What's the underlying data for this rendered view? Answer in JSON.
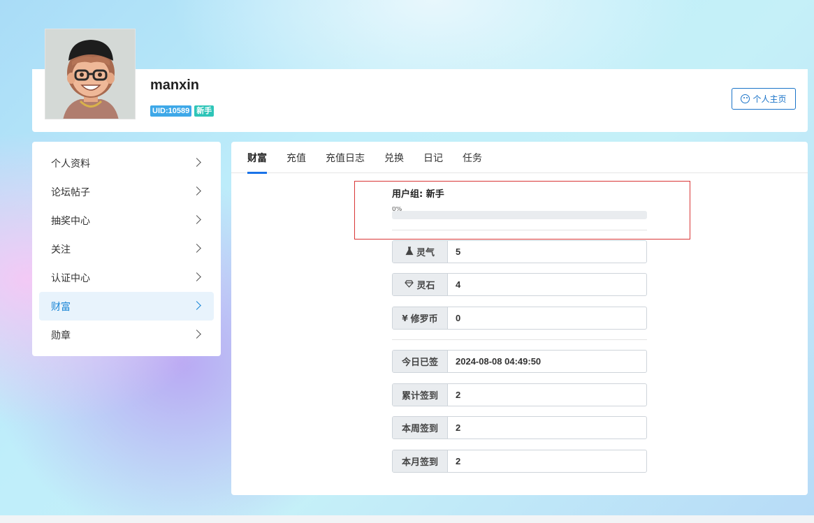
{
  "user": {
    "name": "manxin",
    "uid_badge": "UID:10589",
    "level_badge": "新手",
    "home_button": "个人主页"
  },
  "sidebar": {
    "items": [
      {
        "label": "个人资料"
      },
      {
        "label": "论坛帖子"
      },
      {
        "label": "抽奖中心"
      },
      {
        "label": "关注"
      },
      {
        "label": "认证中心"
      },
      {
        "label": "财富",
        "active": true
      },
      {
        "label": "勋章"
      }
    ]
  },
  "tabs": [
    {
      "label": "财富",
      "active": true
    },
    {
      "label": "充值"
    },
    {
      "label": "充值日志"
    },
    {
      "label": "兑换"
    },
    {
      "label": "日记"
    },
    {
      "label": "任务"
    }
  ],
  "wealth": {
    "group_label": "用户组: 新手",
    "progress_text": "0%",
    "progress_value": 0,
    "stats": [
      {
        "icon": "flask-icon",
        "label": "灵气",
        "value": "5"
      },
      {
        "icon": "diamond-icon",
        "label": "灵石",
        "value": "4"
      },
      {
        "icon": "yen-icon",
        "label": "修罗币",
        "value": "0"
      }
    ],
    "signin": [
      {
        "label": "今日已签",
        "value": "2024-08-08 04:49:50"
      },
      {
        "label": "累计签到",
        "value": "2"
      },
      {
        "label": "本周签到",
        "value": "2"
      },
      {
        "label": "本月签到",
        "value": "2"
      }
    ]
  },
  "colors": {
    "accent": "#1a73e8",
    "active_side": "#1a86d6",
    "highlight_box": "#d93636"
  }
}
